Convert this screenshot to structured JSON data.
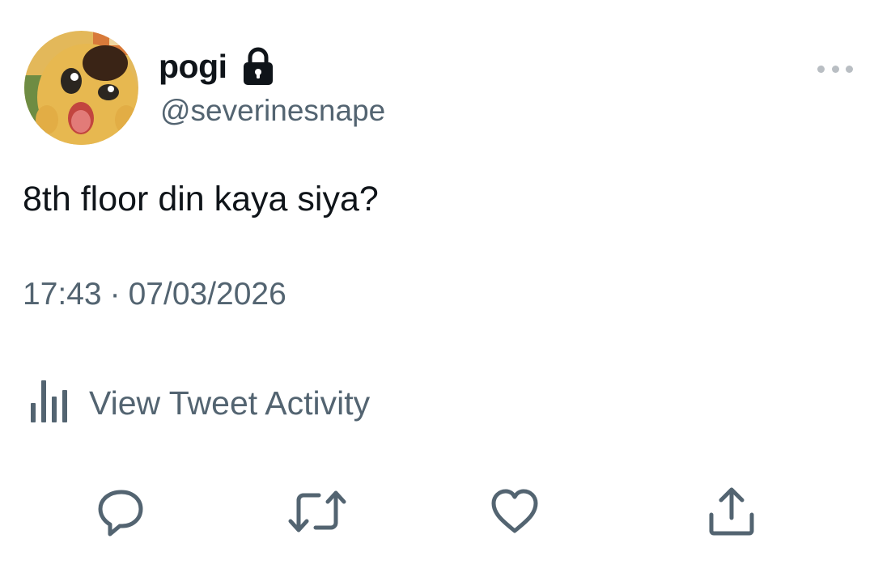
{
  "tweet": {
    "display_name": "pogi",
    "handle": "@severinesnape",
    "text": "8th floor din kaya siya?",
    "time": "17:43",
    "separator": "·",
    "date": "07/03/2026",
    "activity_label": "View Tweet Activity",
    "protected": true
  },
  "icons": {
    "lock": "lock-icon",
    "more": "more-horizontal-icon",
    "analytics": "bar-chart-icon",
    "reply": "speech-bubble-icon",
    "retweet": "retweet-arrows-icon",
    "like": "heart-icon",
    "share": "upload-share-icon"
  },
  "colors": {
    "text_primary": "#0f1419",
    "text_secondary": "#536471",
    "icon": "#536471",
    "dots": "#b9bec3"
  }
}
